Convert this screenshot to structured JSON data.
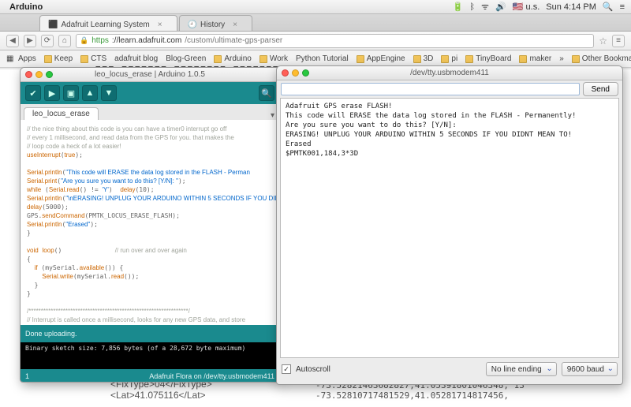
{
  "menubar": {
    "app": "Arduino",
    "battery": "🔋",
    "wifi": "ᯤ",
    "volume": "🔊",
    "bt": "ᛒ",
    "flag": "🇺🇸 u.s.",
    "clock": "Sun 4:14 PM",
    "spotlight": "🔍",
    "notif": "≡"
  },
  "chrome": {
    "tabs": [
      {
        "label": "Adafruit Learning System",
        "icon": "⬛"
      },
      {
        "label": "History",
        "icon": "🕘"
      }
    ],
    "tab_close": "×",
    "nav": {
      "back": "◀",
      "forward": "▶",
      "reload": "⟳",
      "home": "⌂",
      "menu": "≡"
    },
    "url": {
      "lock": "🔒",
      "scheme": "https",
      "host": "://learn.adafruit.com",
      "path": "/custom/ultimate-gps-parser"
    },
    "star": "☆",
    "bookmarks": {
      "apps": "Apps",
      "keep": "Keep",
      "cts": "CTS",
      "adafruit": "adafruit blog",
      "bloggreen": "Blog-Green",
      "arduino": "Arduino",
      "work": "Work",
      "python": "Python Tutorial",
      "appengine": "AppEngine",
      "threed": "3D",
      "pi": "pi",
      "tinyboard": "TinyBoard",
      "maker": "maker",
      "other": "Other Bookmarks",
      "chevron": "»"
    }
  },
  "page": {
    "toprow": "FFF,FFFFFFF,FFFFFFFF,FFFFFFFF,F",
    "xml_fixtype": "<FixType>04</FixType>",
    "xml_lat": "<Lat>41.075116</Lat>",
    "nums": "-73.52821463682827,41.05391801046348,\n13\n-73.52810717481529,41.05281714817456,"
  },
  "ide": {
    "title": "leo_locus_erase | Arduino 1.0.5",
    "tab": "leo_locus_erase",
    "toolbar_icons": [
      "✔",
      "▶",
      "▣",
      "▲",
      "▼"
    ],
    "serial_icon": "🔍",
    "dropdown": "▾",
    "status": "Done uploading.",
    "console": "Binary sketch size: 7,856 bytes (of a 28,672 byte maximum)",
    "footer_left": "1",
    "footer_right": "Adafruit Flora on /dev/tty.usbmodem411"
  },
  "serial": {
    "title": "/dev/tty.usbmodem411",
    "send": "Send",
    "body": "Adafruit GPS erase FLASH!\nThis code will ERASE the data log stored in the FLASH - Permanently!\nAre you sure you want to do this? [Y/N]:\nERASING! UNPLUG YOUR ARDUINO WITHIN 5 SECONDS IF YOU DIDNT MEAN TO!\nErased\n$PMTK001,184,3*3D",
    "autoscroll": "Autoscroll",
    "check": "✓",
    "lineending": "No line ending",
    "baud": "9600 baud"
  }
}
